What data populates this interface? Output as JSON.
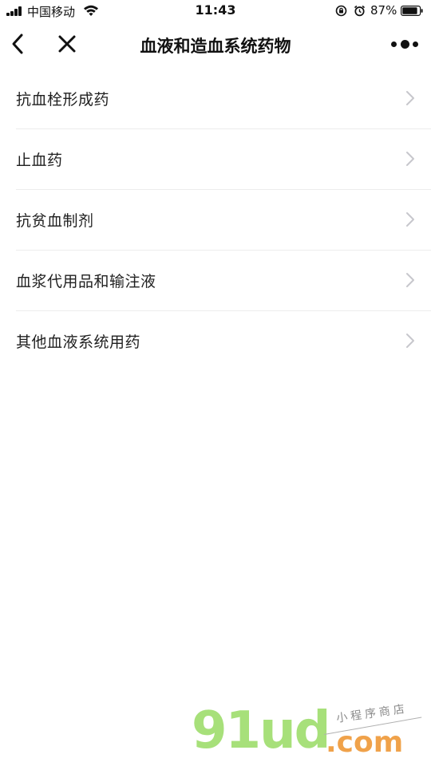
{
  "status_bar": {
    "carrier": "中国移动",
    "time": "11:43",
    "battery_percent": "87%",
    "battery_level": 0.87
  },
  "nav": {
    "title": "血液和造血系统药物"
  },
  "list": {
    "items": [
      {
        "label": "抗血栓形成药"
      },
      {
        "label": "止血药"
      },
      {
        "label": "抗贫血制剂"
      },
      {
        "label": "血浆代用品和输注液"
      },
      {
        "label": "其他血液系统用药"
      }
    ]
  },
  "watermark": {
    "brand": "91ud",
    "suffix": ".com",
    "tagline": "小程序商店"
  },
  "colors": {
    "text": "#1a1a1a",
    "divider": "#ececec",
    "chevron": "#c7c7cc",
    "watermark_green": "#a7e07a",
    "watermark_orange": "#f0a24a"
  }
}
